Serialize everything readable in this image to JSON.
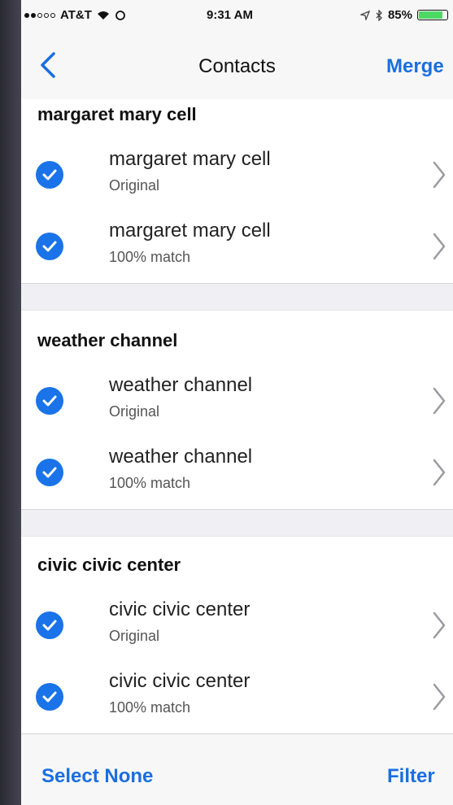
{
  "status_bar": {
    "carrier": "AT&T",
    "time": "9:31 AM",
    "battery": "85%",
    "battery_level": 0.85,
    "signal_bars_filled": 2,
    "signal_bars_total": 5
  },
  "nav": {
    "title": "Contacts",
    "merge_label": "Merge"
  },
  "groups": [
    {
      "header": "margaret mary cell",
      "rows": [
        {
          "title": "margaret mary cell",
          "subtitle": "Original",
          "checked": true
        },
        {
          "title": "margaret mary cell",
          "subtitle": "100% match",
          "checked": true
        }
      ]
    },
    {
      "header": "weather channel",
      "rows": [
        {
          "title": "weather channel",
          "subtitle": "Original",
          "checked": true
        },
        {
          "title": "weather channel",
          "subtitle": "100% match",
          "checked": true
        }
      ]
    },
    {
      "header": "civic civic center",
      "rows": [
        {
          "title": "civic civic center",
          "subtitle": "Original",
          "checked": true
        },
        {
          "title": "civic civic center",
          "subtitle": "100% match",
          "checked": true
        }
      ]
    }
  ],
  "toolbar": {
    "select_none_label": "Select None",
    "filter_label": "Filter"
  },
  "colors": {
    "accent": "#1a6ee0",
    "check": "#1a73e8",
    "battery": "#4cd964"
  }
}
